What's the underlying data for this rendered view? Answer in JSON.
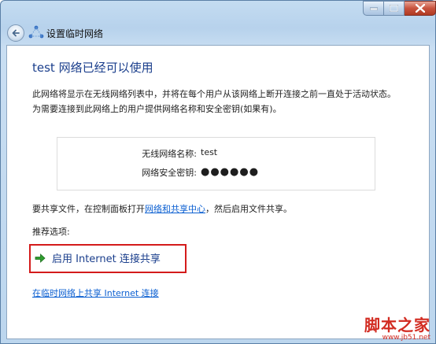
{
  "window": {
    "title": "设置临时网络"
  },
  "content": {
    "heading": "test 网络已经可以使用",
    "description": "此网络将显示在无线网络列表中，并将在每个用户从该网络上断开连接之前一直处于活动状态。为需要连接到此网络上的用户提供网络名称和安全密钥(如果有)。",
    "network_name_label": "无线网络名称:",
    "network_name_value": "test",
    "security_key_label": "网络安全密钥:",
    "security_key_value": "●●●●●●",
    "share_prefix": "要共享文件，在控制面板打开",
    "share_link": "网络和共享中心",
    "share_suffix": "，然后启用文件共享。",
    "recommended_label": "推荐选项:",
    "ics_option": "启用 Internet 连接共享",
    "bottom_link": "在临时网络上共享 Internet 连接"
  },
  "watermark": {
    "main": "脚本之家",
    "sub": "www.jb51.net"
  },
  "colors": {
    "heading": "#1a3e8c",
    "link": "#0b5fd1",
    "highlight": "#d41b1b",
    "close_button": "#c8533e"
  }
}
